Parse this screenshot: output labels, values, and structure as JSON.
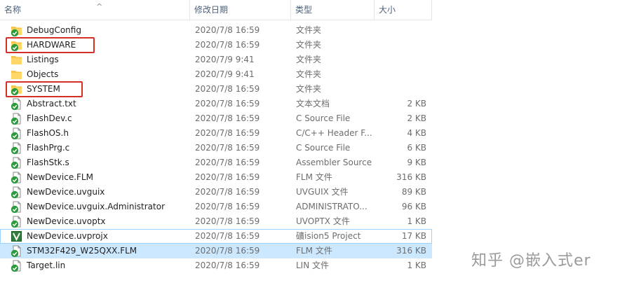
{
  "columns": {
    "name": "名称",
    "date": "修改日期",
    "type": "类型",
    "size": "大小"
  },
  "files": [
    {
      "name": "DebugConfig",
      "date": "2020/7/8 16:59",
      "type": "文件夹",
      "size": "",
      "icon": "folder-synced-icon"
    },
    {
      "name": "HARDWARE",
      "date": "2020/7/8 16:59",
      "type": "文件夹",
      "size": "",
      "icon": "folder-synced-icon"
    },
    {
      "name": "Listings",
      "date": "2020/7/9 9:41",
      "type": "文件夹",
      "size": "",
      "icon": "folder-icon"
    },
    {
      "name": "Objects",
      "date": "2020/7/9 9:41",
      "type": "文件夹",
      "size": "",
      "icon": "folder-icon"
    },
    {
      "name": "SYSTEM",
      "date": "2020/7/8 16:59",
      "type": "文件夹",
      "size": "",
      "icon": "folder-synced-icon"
    },
    {
      "name": "Abstract.txt",
      "date": "2020/7/8 16:59",
      "type": "文本文档",
      "size": "2 KB",
      "icon": "file-synced-icon"
    },
    {
      "name": "FlashDev.c",
      "date": "2020/7/8 16:59",
      "type": "C Source File",
      "size": "2 KB",
      "icon": "file-synced-icon"
    },
    {
      "name": "FlashOS.h",
      "date": "2020/7/8 16:59",
      "type": "C/C++ Header F...",
      "size": "4 KB",
      "icon": "file-synced-icon"
    },
    {
      "name": "FlashPrg.c",
      "date": "2020/7/8 16:59",
      "type": "C Source File",
      "size": "6 KB",
      "icon": "file-synced-icon"
    },
    {
      "name": "FlashStk.s",
      "date": "2020/7/8 16:59",
      "type": "Assembler Source",
      "size": "9 KB",
      "icon": "file-synced-icon"
    },
    {
      "name": "NewDevice.FLM",
      "date": "2020/7/8 16:59",
      "type": "FLM 文件",
      "size": "316 KB",
      "icon": "file-synced-icon"
    },
    {
      "name": "NewDevice.uvguix",
      "date": "2020/7/8 16:59",
      "type": "UVGUIX 文件",
      "size": "89 KB",
      "icon": "file-synced-icon"
    },
    {
      "name": "NewDevice.uvguix.Administrator",
      "date": "2020/7/8 16:59",
      "type": "ADMINISTRATO...",
      "size": "96 KB",
      "icon": "file-synced-icon"
    },
    {
      "name": "NewDevice.uvoptx",
      "date": "2020/7/8 16:59",
      "type": "UVOPTX 文件",
      "size": "1 KB",
      "icon": "file-synced-icon"
    },
    {
      "name": "NewDevice.uvprojx",
      "date": "2020/7/8 16:59",
      "type": "礦ision5 Project",
      "size": "17 KB",
      "icon": "keil-project-icon"
    },
    {
      "name": "STM32F429_W25QXX.FLM",
      "date": "2020/7/8 16:59",
      "type": "FLM 文件",
      "size": "316 KB",
      "icon": "file-synced-icon"
    },
    {
      "name": "Target.lin",
      "date": "2020/7/8 16:59",
      "type": "LIN 文件",
      "size": "1 KB",
      "icon": "file-synced-icon"
    }
  ],
  "watermark": "知乎 @嵌入式er",
  "colors": {
    "highlight": "#d22f27",
    "selection": "#cce8ff",
    "sync_green": "#2e9a3e",
    "folder": "#f5c64b"
  }
}
